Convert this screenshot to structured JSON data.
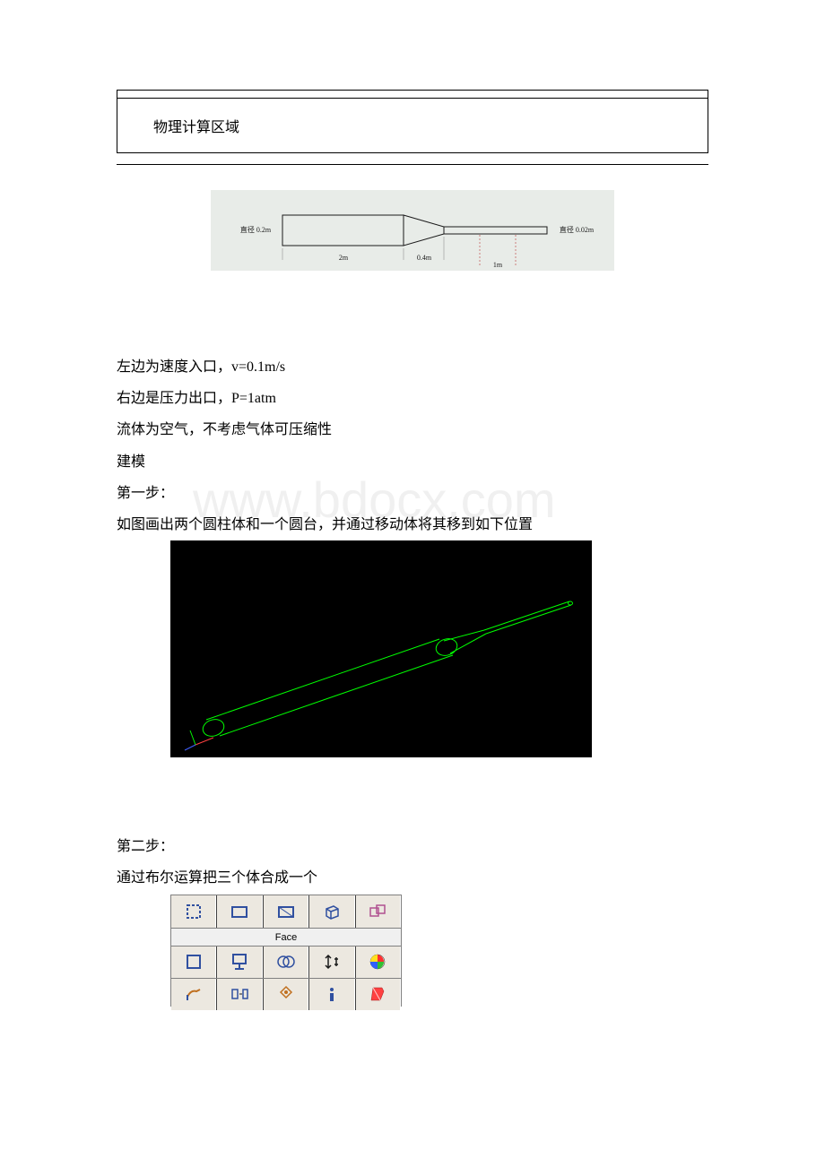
{
  "title_box": {
    "heading": "物理计算区域"
  },
  "physics_diagram": {
    "left_diameter_label": "直径 0.2m",
    "right_diameter_label": "直径 0.02m",
    "length_2m": "2m",
    "length_04m": "0.4m",
    "length_1m": "1m"
  },
  "content": {
    "line1": "左边为速度入口，v=0.1m/s",
    "line2": "右边是压力出口，P=1atm",
    "line3": "流体为空气，不考虑气体可压缩性",
    "line4": "建模",
    "line5": "第一步：",
    "line6": "如图画出两个圆柱体和一个圆台，并通过移动体将其移到如下位置",
    "line7": "第二步：",
    "line8": "通过布尔运算把三个体合成一个"
  },
  "watermark": "www.bdocx.com",
  "toolbar": {
    "row_label": "Face"
  }
}
